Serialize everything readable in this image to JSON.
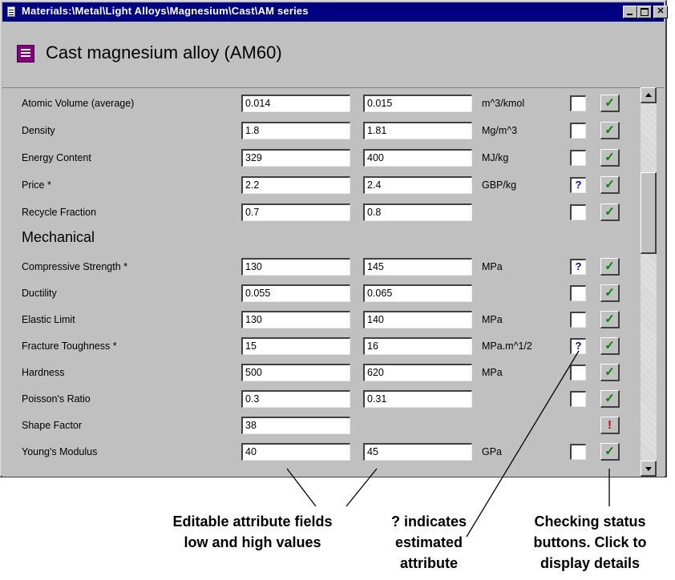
{
  "window": {
    "title": "Materials:\\Metal\\Light Alloys\\Magnesium\\Cast\\AM series",
    "controls": [
      "minimize",
      "maximize",
      "close"
    ],
    "close_glyph": "✕"
  },
  "header": {
    "title": "Cast magnesium alloy (AM60)",
    "icon": "record-icon"
  },
  "rows_top": [
    {
      "label": "Atomic Volume (average)",
      "low": "0.014",
      "high": "0.015",
      "unit": "m^3/kmol",
      "estimated": "",
      "status": "✓"
    },
    {
      "label": "Density",
      "low": "1.8",
      "high": "1.81",
      "unit": "Mg/m^3",
      "estimated": "",
      "status": "✓"
    },
    {
      "label": "Energy Content",
      "low": "329",
      "high": "400",
      "unit": "MJ/kg",
      "estimated": "",
      "status": "✓"
    },
    {
      "label": "Price *",
      "low": "2.2",
      "high": "2.4",
      "unit": "GBP/kg",
      "estimated": "?",
      "status": "✓"
    },
    {
      "label": "Recycle Fraction",
      "low": "0.7",
      "high": "0.8",
      "unit": "",
      "estimated": "",
      "status": "✓"
    }
  ],
  "section": {
    "title": "Mechanical"
  },
  "rows_mech": [
    {
      "label": "Compressive Strength *",
      "low": "130",
      "high": "145",
      "unit": "MPa",
      "estimated": "?",
      "status": "✓"
    },
    {
      "label": "Ductility",
      "low": "0.055",
      "high": "0.065",
      "unit": "",
      "estimated": "",
      "status": "✓"
    },
    {
      "label": "Elastic Limit",
      "low": "130",
      "high": "140",
      "unit": "MPa",
      "estimated": "",
      "status": "✓"
    },
    {
      "label": "Fracture Toughness *",
      "low": "15",
      "high": "16",
      "unit": "MPa.m^1/2",
      "estimated": "?",
      "status": "✓"
    },
    {
      "label": "Hardness",
      "low": "500",
      "high": "620",
      "unit": "MPa",
      "estimated": "",
      "status": "✓"
    },
    {
      "label": "Poisson's Ratio",
      "low": "0.3",
      "high": "0.31",
      "unit": "",
      "estimated": "",
      "status": "✓"
    },
    {
      "label": "Shape Factor",
      "low": "38",
      "high": null,
      "unit": "",
      "estimated": null,
      "status": "!"
    },
    {
      "label": "Young's Modulus",
      "low": "40",
      "high": "45",
      "unit": "GPa",
      "estimated": "",
      "status": "✓"
    }
  ],
  "annotations": {
    "fields": [
      "Editable attribute fields",
      "low and high values"
    ],
    "estimate": [
      "? indicates",
      "estimated",
      "attribute"
    ],
    "status": [
      "Checking status",
      "buttons.  Click to",
      "display details"
    ]
  },
  "colors": {
    "titlebar": "#000080",
    "face": "#c0c0c0",
    "check": "#008000",
    "warning": "#c00000",
    "estimate": "#0000c0"
  }
}
